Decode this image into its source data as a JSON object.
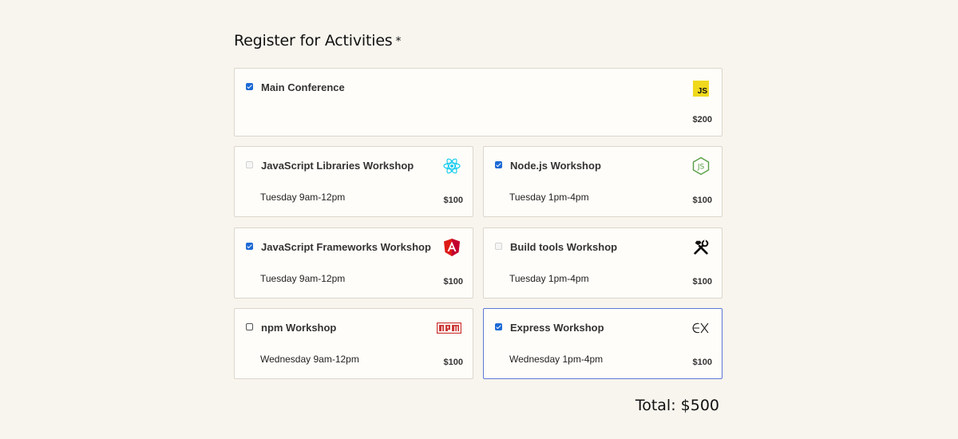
{
  "heading": {
    "text": "Register for Activities",
    "required_mark": "*"
  },
  "activities": [
    {
      "title": "Main Conference",
      "time": "",
      "price": "$200",
      "state": "checked",
      "icon": "javascript-icon",
      "icon_text": "JS"
    },
    {
      "title": "JavaScript Libraries Workshop",
      "time": "Tuesday 9am-12pm",
      "price": "$100",
      "state": "disabled",
      "icon": "react-icon"
    },
    {
      "title": "Node.js Workshop",
      "time": "Tuesday 1pm-4pm",
      "price": "$100",
      "state": "checked",
      "icon": "nodejs-icon"
    },
    {
      "title": "JavaScript Frameworks Workshop",
      "time": "Tuesday 9am-12pm",
      "price": "$100",
      "state": "checked",
      "icon": "angular-icon"
    },
    {
      "title": "Build tools Workshop",
      "time": "Tuesday 1pm-4pm",
      "price": "$100",
      "state": "disabled",
      "icon": "tools-icon"
    },
    {
      "title": "npm Workshop",
      "time": "Wednesday 9am-12pm",
      "price": "$100",
      "state": "unchecked",
      "icon": "npm-icon"
    },
    {
      "title": "Express Workshop",
      "time": "Wednesday 1pm-4pm",
      "price": "$100",
      "state": "checked",
      "icon": "express-icon",
      "focused": true
    }
  ],
  "total": {
    "text": "Total: $500"
  },
  "colors": {
    "background": "#f8f5ee",
    "checkbox": "#1d6ad6",
    "focus_border": "#5b78d6",
    "js_yellow": "#f0d91d",
    "angular_red": "#dd1b16",
    "react_cyan": "#00d8ff",
    "node_green": "#539e43",
    "npm_red": "#cb3837"
  }
}
